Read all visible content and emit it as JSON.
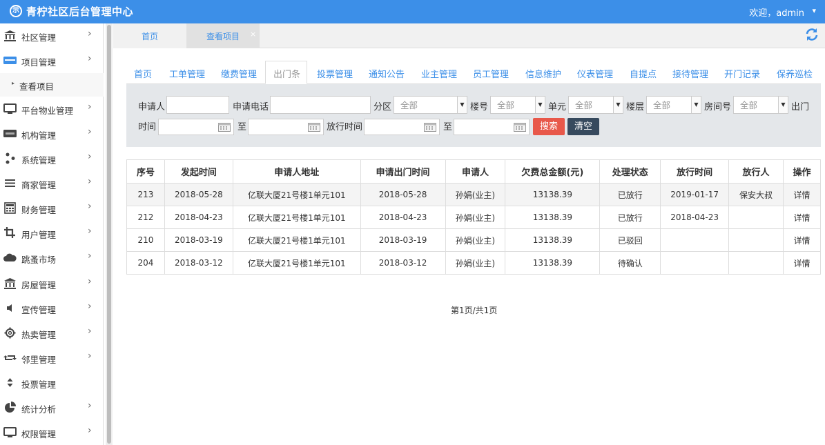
{
  "header": {
    "logo_glyph": "示",
    "title": "青柠社区后台管理中心",
    "welcome": "欢迎，admin",
    "caret": "▾",
    "bg": "#3c8fe8"
  },
  "sidebar": {
    "items": [
      {
        "name": "community",
        "icon": "bank-icon",
        "label": "社区管理",
        "chev": "›"
      },
      {
        "name": "project",
        "icon": "card-icon",
        "label": "项目管理",
        "chev": "›"
      },
      {
        "name": "property",
        "icon": "monitor-icon",
        "label": "平台物业管理",
        "chev": "›"
      },
      {
        "name": "org",
        "icon": "stripe-icon",
        "label": "机构管理",
        "chev": "›"
      },
      {
        "name": "system",
        "icon": "share-icon",
        "label": "系统管理",
        "chev": "›"
      },
      {
        "name": "merchant",
        "icon": "menu-icon",
        "label": "商家管理",
        "chev": "›"
      },
      {
        "name": "finance",
        "icon": "calculator-icon",
        "label": "财务管理",
        "chev": "›"
      },
      {
        "name": "user",
        "icon": "crop-icon",
        "label": "用户管理",
        "chev": "›"
      },
      {
        "name": "market",
        "icon": "cloud-icon",
        "label": "跳蚤市场",
        "chev": "›"
      },
      {
        "name": "house",
        "icon": "bank-icon",
        "label": "房屋管理",
        "chev": "›"
      },
      {
        "name": "publicity",
        "icon": "speaker-icon",
        "label": "宣传管理",
        "chev": "›"
      },
      {
        "name": "hot",
        "icon": "gear-icon",
        "label": "热卖管理",
        "chev": "›"
      },
      {
        "name": "neighbor",
        "icon": "retweet-icon",
        "label": "邻里管理",
        "chev": "›"
      },
      {
        "name": "vote",
        "icon": "sort-icon",
        "label": "投票管理",
        "chev": ""
      },
      {
        "name": "stats",
        "icon": "pie-chart-icon",
        "label": "统计分析",
        "chev": "›"
      },
      {
        "name": "permission",
        "icon": "monitor-icon",
        "label": "权限管理",
        "chev": "›"
      }
    ],
    "sub_item": {
      "arrow": "▸",
      "label": "查看项目"
    }
  },
  "tabs": {
    "home": "首页",
    "current": "查看项目",
    "close": "×"
  },
  "modules": [
    {
      "label": "首页"
    },
    {
      "label": "工单管理"
    },
    {
      "label": "缴费管理"
    },
    {
      "label": "出门条",
      "active": true
    },
    {
      "label": "投票管理"
    },
    {
      "label": "通知公告"
    },
    {
      "label": "业主管理"
    },
    {
      "label": "员工管理"
    },
    {
      "label": "信息维护"
    },
    {
      "label": "仪表管理"
    },
    {
      "label": "自提点"
    },
    {
      "label": "接待管理"
    },
    {
      "label": "开门记录"
    },
    {
      "label": "保养巡检"
    }
  ],
  "search": {
    "applicant": "申请人",
    "phone": "申请电话",
    "zone": "分区",
    "building": "楼号",
    "unit": "单元",
    "floor": "楼层",
    "room": "房间号",
    "out_time": "出门",
    "out_time2": "时间",
    "to": "至",
    "release_time": "放行时间",
    "to2": "至",
    "all": "全部",
    "search_btn": "搜索",
    "clear_btn": "清空"
  },
  "table": {
    "headers": [
      "序号",
      "发起时间",
      "申请人地址",
      "申请出门时间",
      "申请人",
      "欠费总金额(元)",
      "处理状态",
      "放行时间",
      "放行人",
      "操作"
    ],
    "rows": [
      [
        "213",
        "2018-05-28",
        "亿联大厦21号楼1单元101",
        "2018-05-28",
        "孙娟(业主)",
        "13138.39",
        "已放行",
        "2019-01-17",
        "保安大叔",
        "详情"
      ],
      [
        "212",
        "2018-04-23",
        "亿联大厦21号楼1单元101",
        "2018-04-23",
        "孙娟(业主)",
        "13138.39",
        "已放行",
        "2018-04-23",
        "",
        "详情"
      ],
      [
        "210",
        "2018-03-19",
        "亿联大厦21号楼1单元101",
        "2018-03-19",
        "孙娟(业主)",
        "13138.39",
        "已驳回",
        "",
        "",
        "详情"
      ],
      [
        "204",
        "2018-03-12",
        "亿联大厦21号楼1单元101",
        "2018-03-12",
        "孙娟(业主)",
        "13138.39",
        "待确认",
        "",
        "",
        "详情"
      ]
    ]
  },
  "pager": "第1页/共1页"
}
